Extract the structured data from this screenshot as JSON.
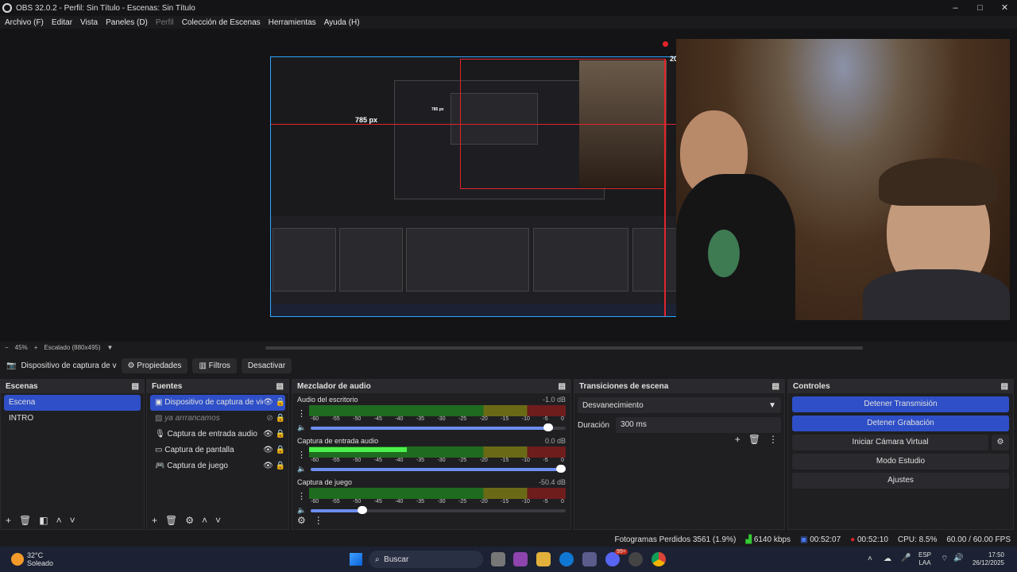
{
  "window": {
    "title": "OBS 32.0.2 - Perfil: Sin Título - Escenas: Sin Título",
    "minimize": "–",
    "maximize": "□",
    "close": "✕"
  },
  "menu": [
    "Archivo (F)",
    "Editar",
    "Vista",
    "Paneles (D)",
    "Perfil",
    "Colección de Escenas",
    "Herramientas",
    "Ayuda (H)"
  ],
  "preview": {
    "measure_label": "785 px",
    "inner_measure": "785 px",
    "corner_label": "20"
  },
  "zoom": {
    "minus": "−",
    "level": "45%",
    "plus": "+",
    "mode": "Escalado (880x495)"
  },
  "source_toolbar": {
    "source_name": "Dispositivo de captura de v",
    "properties": "Propiedades",
    "filters": "Filtros",
    "deactivate": "Desactivar"
  },
  "scenes": {
    "title": "Escenas",
    "items": [
      "Escena",
      "INTRO"
    ]
  },
  "sources": {
    "title": "Fuentes",
    "items": [
      {
        "name": "Dispositivo de captura de vide",
        "icon": "camera-icon"
      },
      {
        "name": "ya arrrancamos",
        "icon": "image-icon"
      },
      {
        "name": "Captura de entrada audio",
        "icon": "mic-icon"
      },
      {
        "name": "Captura de pantalla",
        "icon": "monitor-icon"
      },
      {
        "name": "Captura de juego",
        "icon": "gamepad-icon"
      }
    ]
  },
  "mixer": {
    "title": "Mezclador de audio",
    "ticks": [
      "-60",
      "-55",
      "-50",
      "-45",
      "-40",
      "-35",
      "-30",
      "-25",
      "-20",
      "-15",
      "-10",
      "-5",
      "0"
    ],
    "channels": [
      {
        "name": "Audio del escritorio",
        "db": "-1.0 dB",
        "level": 0,
        "volume": 0.95
      },
      {
        "name": "Captura de entrada audio",
        "db": "0.0 dB",
        "level": 0.38,
        "volume": 1.0
      },
      {
        "name": "Captura de juego",
        "db": "-50.4 dB",
        "level": 0,
        "volume": 0.22
      }
    ]
  },
  "transitions": {
    "title": "Transiciones de escena",
    "selected": "Desvanecimiento",
    "duration_label": "Duración",
    "duration_value": "300 ms"
  },
  "controls": {
    "title": "Controles",
    "buttons": [
      "Detener Transmisión",
      "Detener Grabación",
      "Iniciar Cámara Virtual",
      "Modo Estudio",
      "Ajustes"
    ]
  },
  "status": {
    "dropped_frames": "Fotogramas Perdidos 3561 (1.9%)",
    "bitrate": "6140 kbps",
    "stream_time": "00:52:07",
    "rec_time": "00:52:10",
    "cpu": "CPU: 8.5%",
    "fps": "60.00 / 60.00 FPS"
  },
  "taskbar": {
    "weather_temp": "32°C",
    "weather_desc": "Soleado",
    "search": "Buscar",
    "lang": "ESP",
    "lang2": "LAA",
    "time": "17:50",
    "date": "26/12/2025",
    "badge": "99+"
  }
}
